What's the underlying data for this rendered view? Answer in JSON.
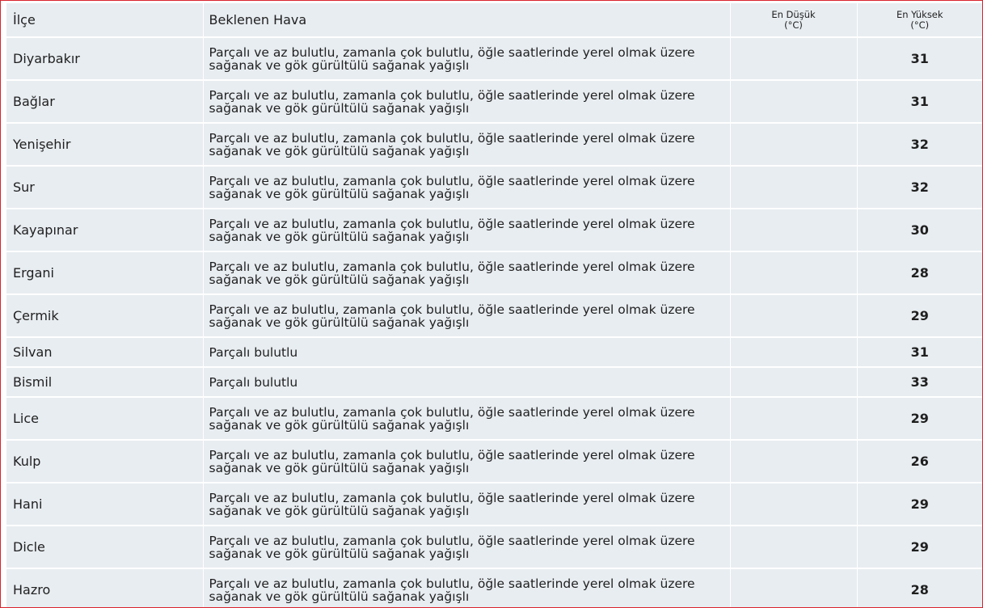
{
  "header": {
    "district": "İlçe",
    "forecast": "Beklenen Hava",
    "min_label": "En Düşük",
    "min_unit": "(°C)",
    "max_label": "En Yüksek",
    "max_unit": "(°C)"
  },
  "colors": {
    "row_bg": "#e8edf1",
    "max_temp": "#d8373a",
    "frame_border": "#d9232d"
  },
  "rows": [
    {
      "district": "Diyarbakır",
      "forecast": "Parçalı ve az bulutlu, zamanla çok bulutlu, öğle saatlerinde yerel olmak üzere sağanak ve gök gürültülü sağanak yağışlı",
      "min": "",
      "max": "31"
    },
    {
      "district": "Bağlar",
      "forecast": "Parçalı ve az bulutlu, zamanla çok bulutlu, öğle saatlerinde yerel olmak üzere sağanak ve gök gürültülü sağanak yağışlı",
      "min": "",
      "max": "31"
    },
    {
      "district": "Yenişehir",
      "forecast": "Parçalı ve az bulutlu, zamanla çok bulutlu, öğle saatlerinde yerel olmak üzere sağanak ve gök gürültülü sağanak yağışlı",
      "min": "",
      "max": "32"
    },
    {
      "district": "Sur",
      "forecast": "Parçalı ve az bulutlu, zamanla çok bulutlu, öğle saatlerinde yerel olmak üzere sağanak ve gök gürültülü sağanak yağışlı",
      "min": "",
      "max": "32"
    },
    {
      "district": "Kayapınar",
      "forecast": "Parçalı ve az bulutlu, zamanla çok bulutlu, öğle saatlerinde yerel olmak üzere sağanak ve gök gürültülü sağanak yağışlı",
      "min": "",
      "max": "30"
    },
    {
      "district": "Ergani",
      "forecast": "Parçalı ve az bulutlu, zamanla çok bulutlu, öğle saatlerinde yerel olmak üzere sağanak ve gök gürültülü sağanak yağışlı",
      "min": "",
      "max": "28"
    },
    {
      "district": "Çermik",
      "forecast": "Parçalı ve az bulutlu, zamanla çok bulutlu, öğle saatlerinde yerel olmak üzere sağanak ve gök gürültülü sağanak yağışlı",
      "min": "",
      "max": "29"
    },
    {
      "district": "Silvan",
      "forecast": "Parçalı bulutlu",
      "min": "",
      "max": "31"
    },
    {
      "district": "Bismil",
      "forecast": "Parçalı bulutlu",
      "min": "",
      "max": "33"
    },
    {
      "district": "Lice",
      "forecast": "Parçalı ve az bulutlu, zamanla çok bulutlu, öğle saatlerinde yerel olmak üzere sağanak ve gök gürültülü sağanak yağışlı",
      "min": "",
      "max": "29"
    },
    {
      "district": "Kulp",
      "forecast": "Parçalı ve az bulutlu, zamanla çok bulutlu, öğle saatlerinde yerel olmak üzere sağanak ve gök gürültülü sağanak yağışlı",
      "min": "",
      "max": "26"
    },
    {
      "district": "Hani",
      "forecast": "Parçalı ve az bulutlu, zamanla çok bulutlu, öğle saatlerinde yerel olmak üzere sağanak ve gök gürültülü sağanak yağışlı",
      "min": "",
      "max": "29"
    },
    {
      "district": "Dicle",
      "forecast": "Parçalı ve az bulutlu, zamanla çok bulutlu, öğle saatlerinde yerel olmak üzere sağanak ve gök gürültülü sağanak yağışlı",
      "min": "",
      "max": "29"
    },
    {
      "district": "Hazro",
      "forecast": "Parçalı ve az bulutlu, zamanla çok bulutlu, öğle saatlerinde yerel olmak üzere sağanak ve gök gürültülü sağanak yağışlı",
      "min": "",
      "max": "28"
    }
  ]
}
